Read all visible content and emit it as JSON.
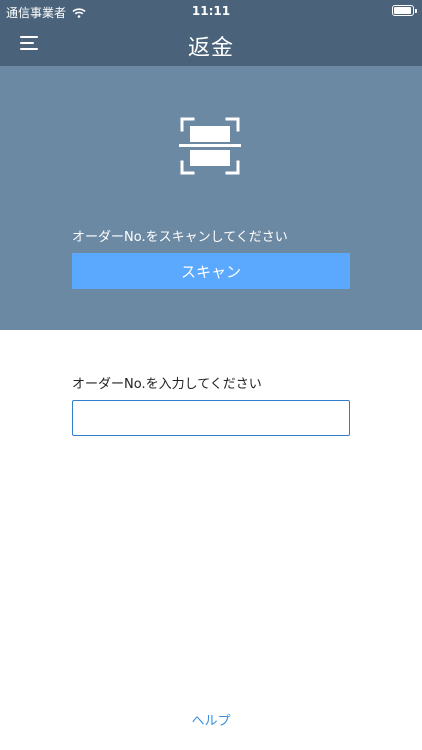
{
  "status_bar": {
    "carrier": "通信事業者",
    "time": "11:11",
    "wifi_icon": "wifi-icon",
    "battery_icon": "battery-icon"
  },
  "nav": {
    "title": "返金",
    "menu_icon": "hamburger-menu-icon"
  },
  "scan_section": {
    "icon": "barcode-scan-icon",
    "instruction": "オーダーNo.をスキャンしてください",
    "button_label": "スキャン"
  },
  "manual_section": {
    "instruction": "オーダーNo.を入力してください",
    "input_value": "",
    "input_placeholder": ""
  },
  "footer": {
    "help_label": "ヘルプ"
  },
  "colors": {
    "header_bg": "#4a637b",
    "scan_panel_bg": "#6c89a3",
    "scan_button_bg": "#5aa9ff",
    "input_border": "#2f7fcc",
    "link": "#3a8fe0"
  }
}
